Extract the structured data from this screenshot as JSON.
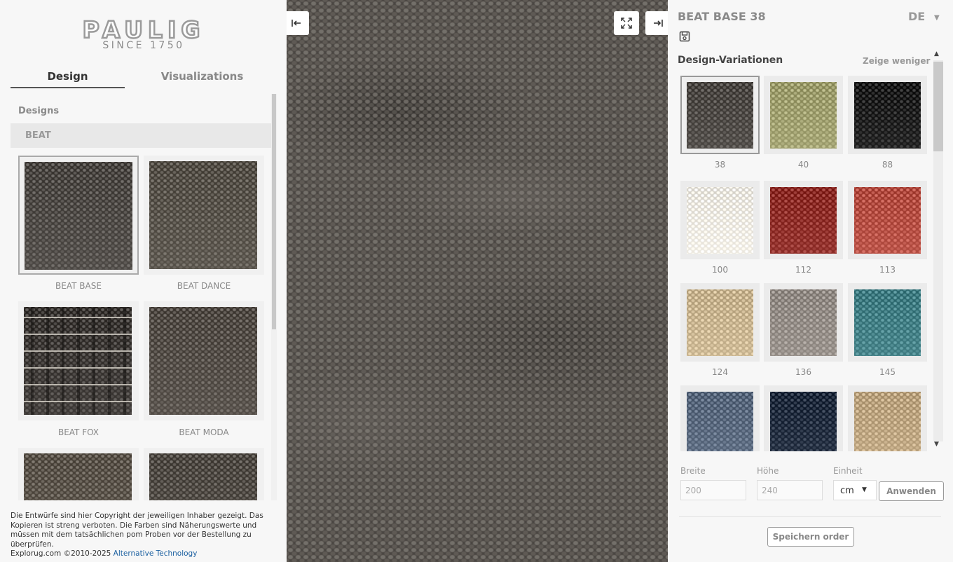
{
  "brand": {
    "logo_text": "PAULIG",
    "since": "SINCE 1750"
  },
  "tabs": [
    {
      "label": "Design",
      "active": true
    },
    {
      "label": "Visualizations",
      "active": false
    }
  ],
  "designs": {
    "heading": "Designs",
    "group": "BEAT",
    "items": [
      {
        "name": "BEAT BASE",
        "selected": true,
        "color": "#4b4743"
      },
      {
        "name": "BEAT DANCE",
        "selected": false,
        "color": "#555048"
      },
      {
        "name": "BEAT FOX",
        "selected": false,
        "color": "#3c3835"
      },
      {
        "name": "BEAT MODA",
        "selected": false,
        "color": "#514b45"
      },
      {
        "name": "",
        "selected": false,
        "color": "#5a534a"
      },
      {
        "name": "",
        "selected": false,
        "color": "#4f4a44"
      }
    ]
  },
  "copyright": {
    "text": "Die Entwürfe sind hier Copyright der jeweiligen Inhaber gezeigt. Das Kopieren ist streng verboten. Die Farben sind Näherungswerte und müssen mit dem tatsächlichen pom Proben vor der Bestellung zu überprüfen.",
    "site": "Explorug.com ©2010-2025",
    "link": "Alternative Technology"
  },
  "center": {
    "collapse_left_icon": "collapse-left-icon",
    "fullscreen_icon": "fullscreen-icon",
    "expand_right_icon": "expand-right-icon"
  },
  "right": {
    "title": "BEAT BASE 38",
    "language": "DE",
    "save_icon": "save-icon",
    "variations_title": "Design-Variationen",
    "show_less": "Zeige weniger",
    "variations": [
      {
        "label": "38",
        "color": "#4a4642",
        "selected": true
      },
      {
        "label": "40",
        "color": "#9a9a6a",
        "selected": false
      },
      {
        "label": "88",
        "color": "#1c1c1c",
        "selected": false
      },
      {
        "label": "100",
        "color": "#ece8df",
        "selected": false
      },
      {
        "label": "112",
        "color": "#8a2a25",
        "selected": false
      },
      {
        "label": "113",
        "color": "#b04a3f",
        "selected": false
      },
      {
        "label": "124",
        "color": "#c4b08c",
        "selected": false
      },
      {
        "label": "136",
        "color": "#8f8882",
        "selected": false
      },
      {
        "label": "145",
        "color": "#3e7a80",
        "selected": false
      },
      {
        "label": "",
        "color": "#56657a",
        "selected": false
      },
      {
        "label": "",
        "color": "#1f2a3c",
        "selected": false
      },
      {
        "label": "",
        "color": "#b8a07c",
        "selected": false
      }
    ],
    "size": {
      "width_label": "Breite",
      "width_value": "200",
      "height_label": "Höhe",
      "height_value": "240",
      "unit_label": "Einheit",
      "unit_value": "cm",
      "apply_label": "Anwenden"
    },
    "save_order_label": "Speichern order"
  }
}
